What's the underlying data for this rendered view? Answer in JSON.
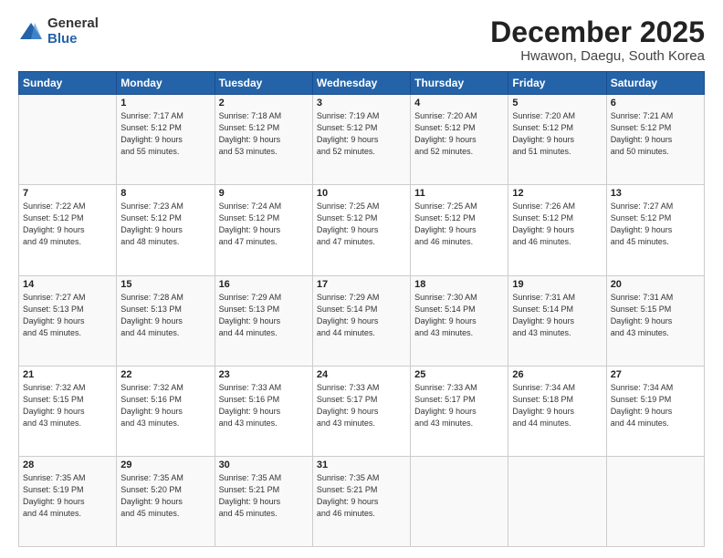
{
  "logo": {
    "general": "General",
    "blue": "Blue"
  },
  "header": {
    "month": "December 2025",
    "location": "Hwawon, Daegu, South Korea"
  },
  "weekdays": [
    "Sunday",
    "Monday",
    "Tuesday",
    "Wednesday",
    "Thursday",
    "Friday",
    "Saturday"
  ],
  "weeks": [
    [
      {
        "day": "",
        "info": ""
      },
      {
        "day": "1",
        "info": "Sunrise: 7:17 AM\nSunset: 5:12 PM\nDaylight: 9 hours\nand 55 minutes."
      },
      {
        "day": "2",
        "info": "Sunrise: 7:18 AM\nSunset: 5:12 PM\nDaylight: 9 hours\nand 53 minutes."
      },
      {
        "day": "3",
        "info": "Sunrise: 7:19 AM\nSunset: 5:12 PM\nDaylight: 9 hours\nand 52 minutes."
      },
      {
        "day": "4",
        "info": "Sunrise: 7:20 AM\nSunset: 5:12 PM\nDaylight: 9 hours\nand 52 minutes."
      },
      {
        "day": "5",
        "info": "Sunrise: 7:20 AM\nSunset: 5:12 PM\nDaylight: 9 hours\nand 51 minutes."
      },
      {
        "day": "6",
        "info": "Sunrise: 7:21 AM\nSunset: 5:12 PM\nDaylight: 9 hours\nand 50 minutes."
      }
    ],
    [
      {
        "day": "7",
        "info": "Sunrise: 7:22 AM\nSunset: 5:12 PM\nDaylight: 9 hours\nand 49 minutes."
      },
      {
        "day": "8",
        "info": "Sunrise: 7:23 AM\nSunset: 5:12 PM\nDaylight: 9 hours\nand 48 minutes."
      },
      {
        "day": "9",
        "info": "Sunrise: 7:24 AM\nSunset: 5:12 PM\nDaylight: 9 hours\nand 47 minutes."
      },
      {
        "day": "10",
        "info": "Sunrise: 7:25 AM\nSunset: 5:12 PM\nDaylight: 9 hours\nand 47 minutes."
      },
      {
        "day": "11",
        "info": "Sunrise: 7:25 AM\nSunset: 5:12 PM\nDaylight: 9 hours\nand 46 minutes."
      },
      {
        "day": "12",
        "info": "Sunrise: 7:26 AM\nSunset: 5:12 PM\nDaylight: 9 hours\nand 46 minutes."
      },
      {
        "day": "13",
        "info": "Sunrise: 7:27 AM\nSunset: 5:12 PM\nDaylight: 9 hours\nand 45 minutes."
      }
    ],
    [
      {
        "day": "14",
        "info": "Sunrise: 7:27 AM\nSunset: 5:13 PM\nDaylight: 9 hours\nand 45 minutes."
      },
      {
        "day": "15",
        "info": "Sunrise: 7:28 AM\nSunset: 5:13 PM\nDaylight: 9 hours\nand 44 minutes."
      },
      {
        "day": "16",
        "info": "Sunrise: 7:29 AM\nSunset: 5:13 PM\nDaylight: 9 hours\nand 44 minutes."
      },
      {
        "day": "17",
        "info": "Sunrise: 7:29 AM\nSunset: 5:14 PM\nDaylight: 9 hours\nand 44 minutes."
      },
      {
        "day": "18",
        "info": "Sunrise: 7:30 AM\nSunset: 5:14 PM\nDaylight: 9 hours\nand 43 minutes."
      },
      {
        "day": "19",
        "info": "Sunrise: 7:31 AM\nSunset: 5:14 PM\nDaylight: 9 hours\nand 43 minutes."
      },
      {
        "day": "20",
        "info": "Sunrise: 7:31 AM\nSunset: 5:15 PM\nDaylight: 9 hours\nand 43 minutes."
      }
    ],
    [
      {
        "day": "21",
        "info": "Sunrise: 7:32 AM\nSunset: 5:15 PM\nDaylight: 9 hours\nand 43 minutes."
      },
      {
        "day": "22",
        "info": "Sunrise: 7:32 AM\nSunset: 5:16 PM\nDaylight: 9 hours\nand 43 minutes."
      },
      {
        "day": "23",
        "info": "Sunrise: 7:33 AM\nSunset: 5:16 PM\nDaylight: 9 hours\nand 43 minutes."
      },
      {
        "day": "24",
        "info": "Sunrise: 7:33 AM\nSunset: 5:17 PM\nDaylight: 9 hours\nand 43 minutes."
      },
      {
        "day": "25",
        "info": "Sunrise: 7:33 AM\nSunset: 5:17 PM\nDaylight: 9 hours\nand 43 minutes."
      },
      {
        "day": "26",
        "info": "Sunrise: 7:34 AM\nSunset: 5:18 PM\nDaylight: 9 hours\nand 44 minutes."
      },
      {
        "day": "27",
        "info": "Sunrise: 7:34 AM\nSunset: 5:19 PM\nDaylight: 9 hours\nand 44 minutes."
      }
    ],
    [
      {
        "day": "28",
        "info": "Sunrise: 7:35 AM\nSunset: 5:19 PM\nDaylight: 9 hours\nand 44 minutes."
      },
      {
        "day": "29",
        "info": "Sunrise: 7:35 AM\nSunset: 5:20 PM\nDaylight: 9 hours\nand 45 minutes."
      },
      {
        "day": "30",
        "info": "Sunrise: 7:35 AM\nSunset: 5:21 PM\nDaylight: 9 hours\nand 45 minutes."
      },
      {
        "day": "31",
        "info": "Sunrise: 7:35 AM\nSunset: 5:21 PM\nDaylight: 9 hours\nand 46 minutes."
      },
      {
        "day": "",
        "info": ""
      },
      {
        "day": "",
        "info": ""
      },
      {
        "day": "",
        "info": ""
      }
    ]
  ]
}
